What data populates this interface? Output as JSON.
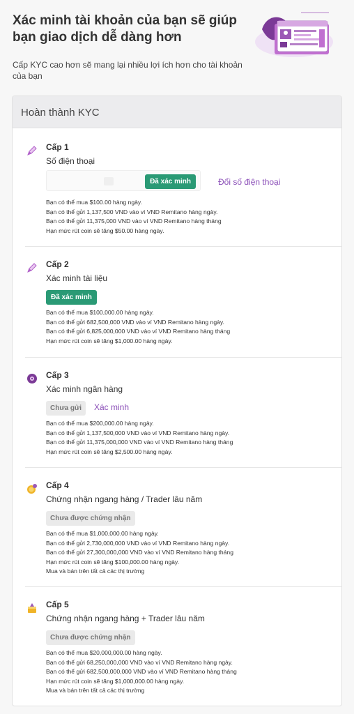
{
  "header": {
    "title": "Xác minh tài khoản của bạn sẽ giúp bạn giao dịch dễ dàng hơn",
    "subtitle": "Cấp KYC cao hơn sẽ mang lại nhiều lợi ích hơn cho tài khoản của bạn"
  },
  "card": {
    "title": "Hoàn thành KYC"
  },
  "levels": [
    {
      "title": "Cấp 1",
      "name": "Số điện thoại",
      "icon": "pencil-icon",
      "status": "Đã xác minh",
      "action": "Đổi số điện thoại",
      "benefits": [
        "Bạn có thể mua $100.00 hàng ngày.",
        "Bạn có thể gửi 1,137,500 VND vào ví VND Remitano hàng ngày.",
        "Bạn có thể gửi 11,375,000 VND vào ví VND Remitano hàng tháng",
        "Hạn mức rút coin sẽ tăng $50.00 hàng ngày."
      ]
    },
    {
      "title": "Cấp 2",
      "name": "Xác minh tài liệu",
      "icon": "pencil-icon",
      "status": "Đã xác minh",
      "benefits": [
        "Bạn có thể mua $100,000.00 hàng ngày.",
        "Bạn có thể gửi 682,500,000 VND vào ví VND Remitano hàng ngày.",
        "Bạn có thể gửi 6,825,000,000 VND vào ví VND Remitano hàng tháng",
        "Hạn mức rút coin sẽ tăng $1,000.00 hàng ngày."
      ]
    },
    {
      "title": "Cấp 3",
      "name": "Xác minh ngân hàng",
      "icon": "bank-disc-icon",
      "status": "Chưa gửi",
      "action": "Xác minh",
      "benefits": [
        "Bạn có thể mua $200,000.00 hàng ngày.",
        "Bạn có thể gửi 1,137,500,000 VND vào ví VND Remitano hàng ngày.",
        "Bạn có thể gửi 11,375,000,000 VND vào ví VND Remitano hàng tháng",
        "Hạn mức rút coin sẽ tăng $2,500.00 hàng ngày."
      ]
    },
    {
      "title": "Cấp 4",
      "name": "Chứng nhận ngang hàng / Trader lâu năm",
      "icon": "coins-icon",
      "status": "Chưa được chứng nhận",
      "benefits": [
        "Bạn có thể mua $1,000,000.00 hàng ngày.",
        "Bạn có thể gửi 2,730,000,000 VND vào ví VND Remitano hàng ngày.",
        "Bạn có thể gửi 27,300,000,000 VND vào ví VND Remitano hàng tháng",
        "Hạn mức rút coin sẽ tăng $100,000.00 hàng ngày.",
        "Mua và bán trên tất cả các thị trường"
      ]
    },
    {
      "title": "Cấp 5",
      "name": "Chứng nhận ngang hàng + Trader lâu năm",
      "icon": "coin-stack-icon",
      "status": "Chưa được chứng nhận",
      "benefits": [
        "Bạn có thể mua $20,000,000.00 hàng ngày.",
        "Bạn có thể gửi 68,250,000,000 VND vào ví VND Remitano hàng ngày.",
        "Bạn có thể gửi 682,500,000,000 VND vào ví VND Remitano hàng tháng",
        "Hạn mức rút coin sẽ tăng $1,000,000.00 hàng ngày.",
        "Mua và bán trên tất cả các thị trường"
      ]
    }
  ],
  "colors": {
    "accent": "#8b4fb8",
    "verified": "#2a9a75",
    "pending": "#eaeaea"
  }
}
